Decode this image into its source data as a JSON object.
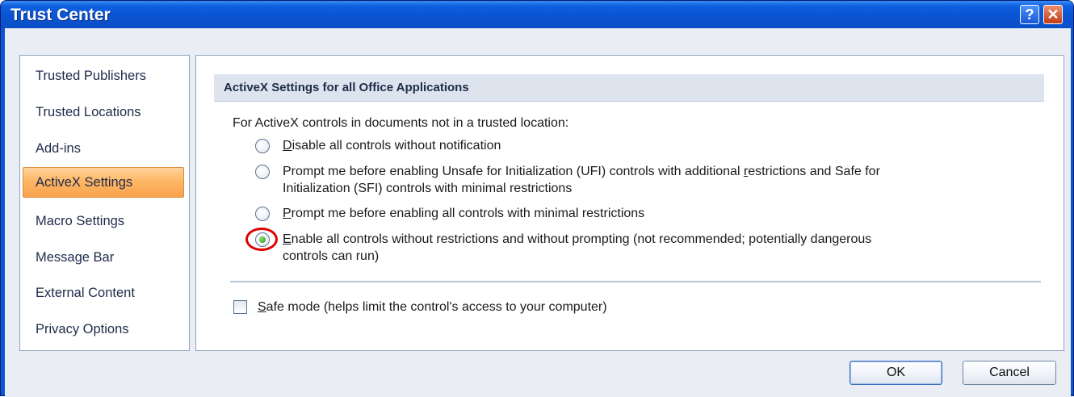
{
  "window": {
    "title": "Trust Center",
    "help_button": "?",
    "close_button": "✕"
  },
  "sidebar": {
    "items": [
      {
        "label": "Trusted Publishers",
        "active": false
      },
      {
        "label": "Trusted Locations",
        "active": false
      },
      {
        "label": "Add-ins",
        "active": false
      },
      {
        "label": "ActiveX Settings",
        "active": true
      },
      {
        "label": "Macro Settings",
        "active": false
      },
      {
        "label": "Message Bar",
        "active": false
      },
      {
        "label": "External Content",
        "active": false
      },
      {
        "label": "Privacy Options",
        "active": false
      }
    ]
  },
  "main": {
    "section_title": "ActiveX Settings for all Office Applications",
    "intro": "For ActiveX controls in documents not in a trusted location:",
    "options": [
      {
        "accel": "D",
        "rest_line1": "isable all controls without notification",
        "line2": "",
        "checked": false
      },
      {
        "prefix": "Prompt me before enabling Unsafe for Initialization (UFI) controls with additional ",
        "accel": "r",
        "rest_line1": "estrictions and Safe for",
        "line2": "Initialization (SFI) controls with minimal restrictions",
        "checked": false
      },
      {
        "accel": "P",
        "rest_line1": "rompt me before enabling all controls with minimal restrictions",
        "line2": "",
        "checked": false
      },
      {
        "accel": "E",
        "rest_line1": "nable all controls without restrictions and without prompting (not recommended; potentially dangerous",
        "line2": "controls can run)",
        "checked": true
      }
    ],
    "safe_mode": {
      "accel": "S",
      "rest": "afe mode (helps limit the control's access to your computer)",
      "checked": false
    }
  },
  "buttons": {
    "ok": "OK",
    "cancel": "Cancel"
  },
  "colors": {
    "titlebar": "#0a52d0",
    "active_nav": "#fdb767",
    "highlight_ring": "#e00000"
  }
}
